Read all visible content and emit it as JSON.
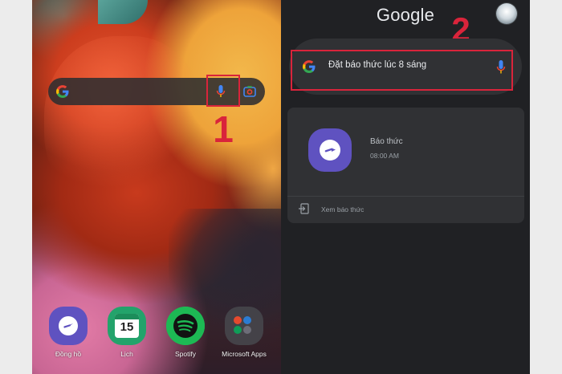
{
  "left_screen": {
    "step_number": "1",
    "dock": [
      {
        "label": "Đồng hồ",
        "icon": "clock-icon"
      },
      {
        "label": "Lịch",
        "icon": "calendar-icon",
        "day": "15"
      },
      {
        "label": "Spotify",
        "icon": "spotify-icon"
      },
      {
        "label": "Microsoft Apps",
        "icon": "folder-icon"
      }
    ]
  },
  "right_screen": {
    "brand": "Google",
    "step_number": "2",
    "search": {
      "query": "Đặt báo thức lúc 8 sáng"
    },
    "result": {
      "title": "Báo thức",
      "time": "08:00 AM",
      "view_link": "Xem báo thức"
    }
  },
  "colors": {
    "highlight": "#d9243b",
    "alarm_accent": "#5f52c0",
    "dark_surface": "#303134"
  }
}
